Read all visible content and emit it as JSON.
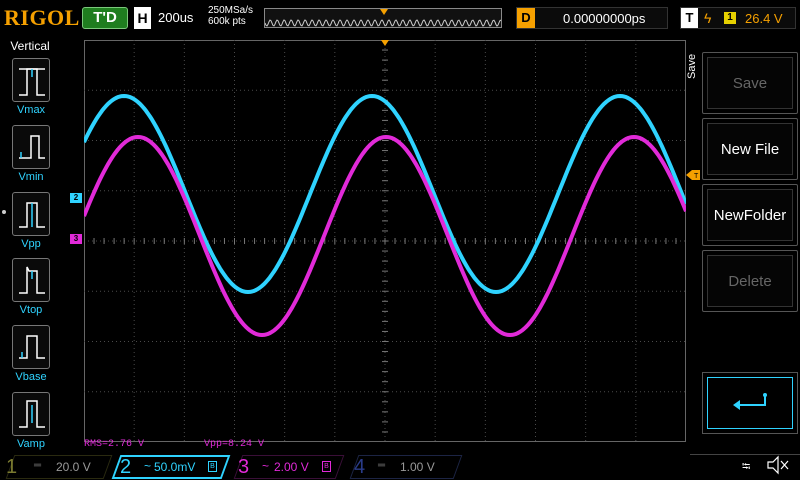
{
  "top": {
    "logo": "RIGOL",
    "trigger_status": "T'D",
    "horizontal_label": "H",
    "timebase": "200us",
    "sample_rate": "250MSa/s",
    "memory_depth": "600k pts",
    "delay_label": "D",
    "delay_value": "0.00000000ps",
    "trigger_label": "T",
    "trigger_source": "1",
    "trigger_level": "26.4 V"
  },
  "left_panel": {
    "title": "Vertical",
    "items": [
      {
        "label": "Vmax",
        "icon": "vmax-icon"
      },
      {
        "label": "Vmin",
        "icon": "vmin-icon"
      },
      {
        "label": "Vpp",
        "icon": "vpp-icon"
      },
      {
        "label": "Vtop",
        "icon": "vtop-icon"
      },
      {
        "label": "Vbase",
        "icon": "vbase-icon"
      },
      {
        "label": "Vamp",
        "icon": "vamp-icon"
      }
    ]
  },
  "channel_markers": {
    "ch2": "2",
    "ch3": "3"
  },
  "measurements": {
    "rms": "RMS=2.76 V",
    "vpp": "Vpp=8.24 V"
  },
  "menu": {
    "tab": "Save",
    "buttons": [
      {
        "label": "Save",
        "enabled": false
      },
      {
        "label": "New File",
        "enabled": true
      },
      {
        "label": "NewFolder",
        "enabled": true
      },
      {
        "label": "Delete",
        "enabled": false
      }
    ],
    "enter_icon": "enter-icon"
  },
  "channels": [
    {
      "num": "1",
      "coupling": "DC",
      "scale": "20.0 V",
      "color": "#7a7a30",
      "active": false
    },
    {
      "num": "2",
      "coupling": "~",
      "scale": "50.0mV",
      "color": "#2fd3ff",
      "active": true,
      "bw": "B"
    },
    {
      "num": "3",
      "coupling": "~",
      "scale": "2.00 V",
      "color": "#e12ad8",
      "active": false,
      "bw": "B"
    },
    {
      "num": "4",
      "coupling": "DC",
      "scale": "1.00 V",
      "color": "#2a3c8a",
      "active": false
    }
  ],
  "colors": {
    "ch2": "#2fd3ff",
    "ch3": "#e12ad8",
    "trigger": "#f5a000",
    "grid": "#4a4a4a"
  }
}
